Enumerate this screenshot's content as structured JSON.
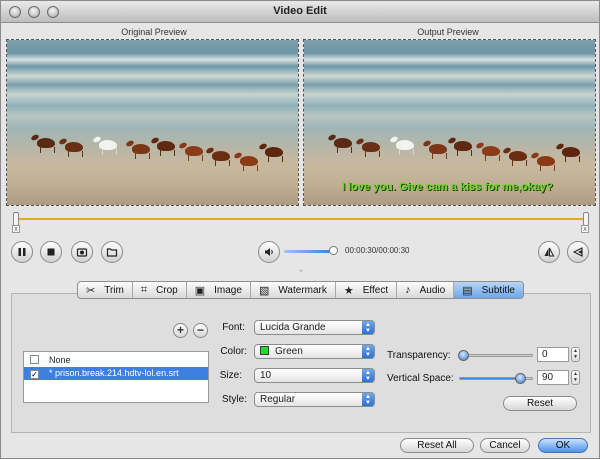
{
  "window": {
    "title": "Video Edit"
  },
  "preview": {
    "original_label": "Original Preview",
    "output_label": "Output Preview",
    "subtitle_text": "I love you. Give cam a kiss for me,okay?"
  },
  "playback": {
    "time": "00:00:30/00:00:30",
    "timeline_start_x": "x",
    "timeline_end_x": "x",
    "pause_icon": "pause-icon",
    "stop_icon": "stop-icon",
    "volume_level": 0.85
  },
  "tabs": [
    {
      "label": "Trim",
      "icon": "scissors-icon"
    },
    {
      "label": "Crop",
      "icon": "crop-icon"
    },
    {
      "label": "Image",
      "icon": "image-icon"
    },
    {
      "label": "Watermark",
      "icon": "watermark-icon"
    },
    {
      "label": "Effect",
      "icon": "star-icon"
    },
    {
      "label": "Audio",
      "icon": "music-note-icon"
    },
    {
      "label": "Subtitle",
      "icon": "subtitle-icon",
      "active": true
    }
  ],
  "subtitle": {
    "add_symbol": "+",
    "remove_symbol": "−",
    "list": [
      {
        "label": "None",
        "checked": false,
        "selected": false
      },
      {
        "label": "* prison.break.214.hdtv-lol.en.srt",
        "checked": true,
        "selected": true
      }
    ],
    "font_label": "Font:",
    "font_value": "Lucida Grande",
    "color_label": "Color:",
    "color_value": "Green",
    "color_hex": "#2bd82b",
    "size_label": "Size:",
    "size_value": "10",
    "style_label": "Style:",
    "style_value": "Regular",
    "transparency_label": "Transparency:",
    "transparency_value": "0",
    "vertical_space_label": "Vertical Space:",
    "vertical_space_value": "90",
    "reset_label": "Reset"
  },
  "footer": {
    "reset_all_label": "Reset All",
    "cancel_label": "Cancel",
    "ok_label": "OK"
  },
  "colors": {
    "timeline_track": "#e5a62a",
    "accent_blue": "#3d80df",
    "subtitle_green": "#6bd62a"
  }
}
